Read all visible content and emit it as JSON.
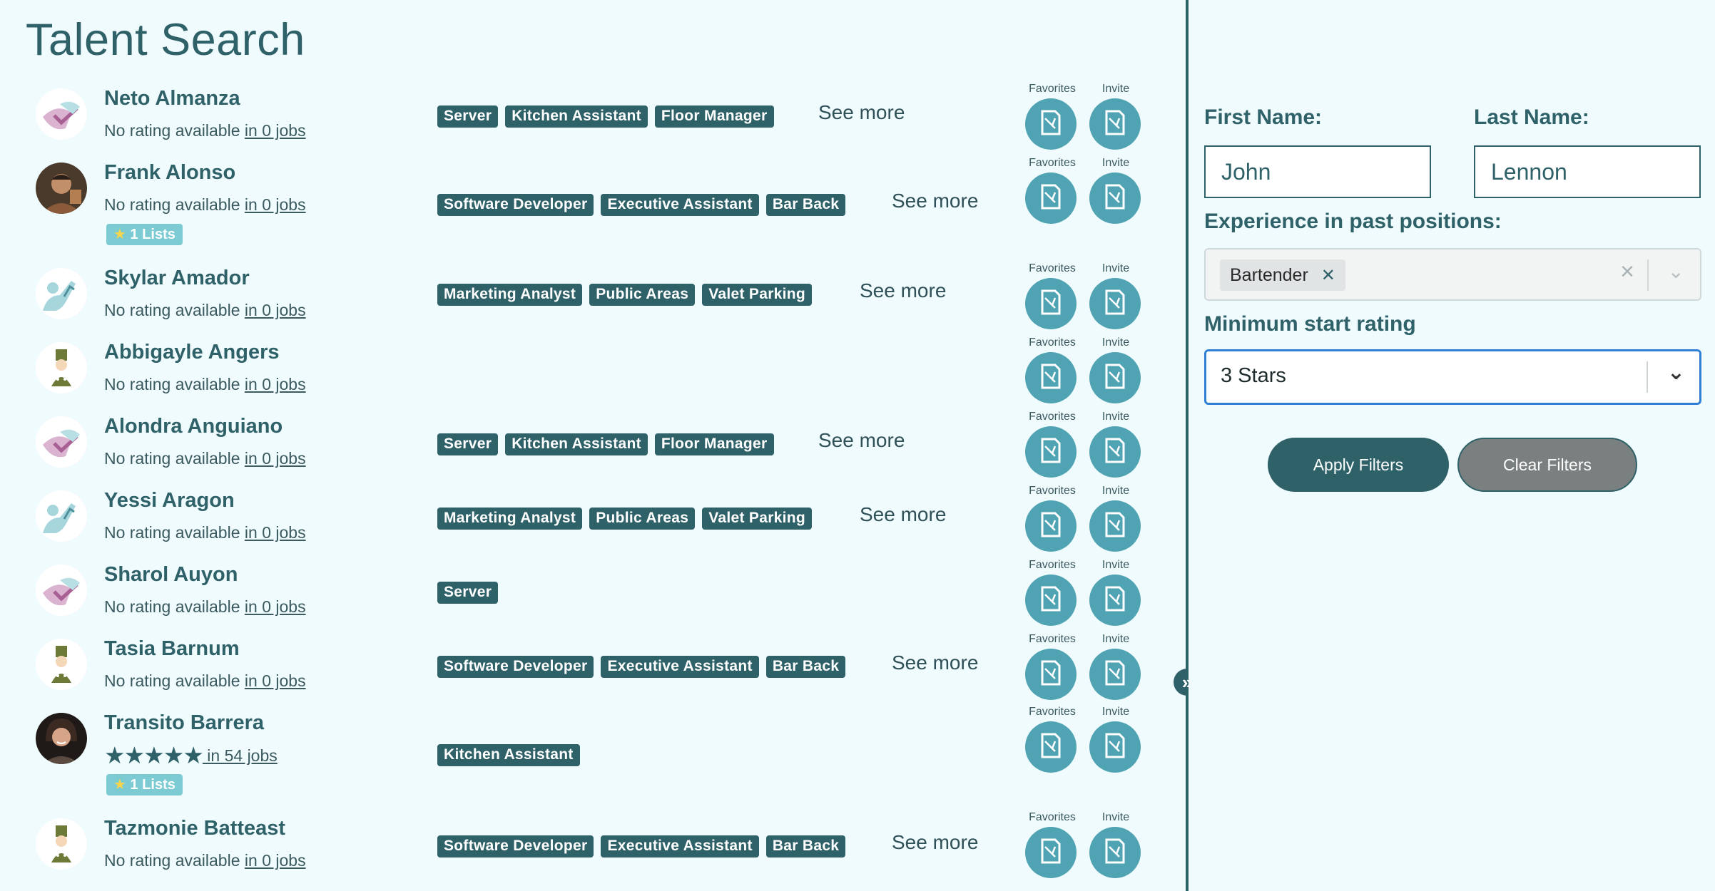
{
  "page_title": "Talent Search",
  "action_labels": {
    "favorites": "Favorites",
    "invite": "Invite"
  },
  "see_more_label": "See more",
  "candidates": [
    {
      "name": "Neto Almanza",
      "rating_text": "No rating available",
      "jobs_text": "in 0 jobs",
      "tags": [
        "Server",
        "Kitchen Assistant",
        "Floor Manager"
      ],
      "see_more": true
    },
    {
      "name": "Frank Alonso",
      "rating_text": "No rating available",
      "jobs_text": "in 0 jobs",
      "lists": "1 Lists",
      "tags": [
        "Software Developer",
        "Executive Assistant",
        "Bar Back"
      ],
      "see_more": true
    },
    {
      "name": "Skylar Amador",
      "rating_text": "No rating available",
      "jobs_text": "in 0 jobs",
      "tags": [
        "Marketing Analyst",
        "Public Areas",
        "Valet Parking"
      ],
      "see_more": true
    },
    {
      "name": "Abbigayle Angers",
      "rating_text": "No rating available",
      "jobs_text": "in 0 jobs",
      "tags": [],
      "see_more": false
    },
    {
      "name": "Alondra Anguiano",
      "rating_text": "No rating available",
      "jobs_text": "in 0 jobs",
      "tags": [
        "Server",
        "Kitchen Assistant",
        "Floor Manager"
      ],
      "see_more": true
    },
    {
      "name": "Yessi Aragon",
      "rating_text": "No rating available",
      "jobs_text": "in 0 jobs",
      "tags": [
        "Marketing Analyst",
        "Public Areas",
        "Valet Parking"
      ],
      "see_more": true
    },
    {
      "name": "Sharol Auyon",
      "rating_text": "No rating available",
      "jobs_text": "in 0 jobs",
      "tags": [
        "Server"
      ],
      "see_more": false
    },
    {
      "name": "Tasia Barnum",
      "rating_text": "No rating available",
      "jobs_text": "in 0 jobs",
      "tags": [
        "Software Developer",
        "Executive Assistant",
        "Bar Back"
      ],
      "see_more": true
    },
    {
      "name": "Transito Barrera",
      "rating_stars": 5,
      "jobs_text": " in 54 jobs",
      "lists": "1 Lists",
      "tags": [
        "Kitchen Assistant"
      ],
      "see_more": false
    },
    {
      "name": "Tazmonie Batteast",
      "rating_text": "No rating available",
      "jobs_text": "in 0 jobs",
      "tags": [
        "Software Developer",
        "Executive Assistant",
        "Bar Back"
      ],
      "see_more": true
    }
  ],
  "filters": {
    "first_name_label": "First Name:",
    "first_name_value": "John",
    "last_name_label": "Last Name:",
    "last_name_value": "Lennon",
    "experience_label": "Experience in past positions:",
    "experience_selected": [
      "Bartender"
    ],
    "min_rating_label": "Minimum start rating",
    "min_rating_value": "3 Stars",
    "apply_label": "Apply Filters",
    "clear_label": "Clear Filters"
  },
  "colors": {
    "background": "#f0fbfe",
    "primary": "#2f6169",
    "action_button": "#4fa3b3",
    "lists_badge": "#7ccbd3",
    "focus": "#2f7fd6"
  }
}
